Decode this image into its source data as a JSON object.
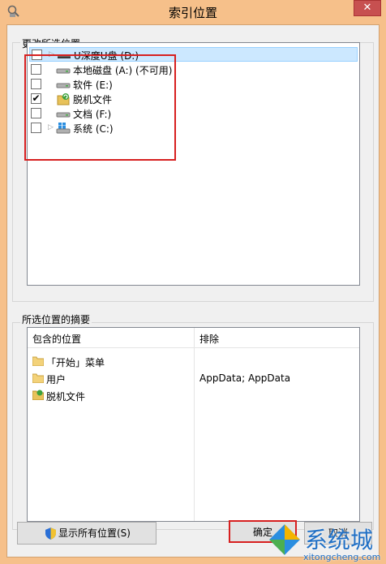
{
  "window": {
    "title": "索引位置",
    "close_glyph": "✕"
  },
  "change_group": {
    "label": "更改所选位置",
    "items": [
      {
        "label": "U深度U盘 (D:)",
        "checked": false,
        "expandable": true,
        "icon": "usb-drive-icon",
        "selected": true
      },
      {
        "label": "本地磁盘 (A:) (不可用)",
        "checked": false,
        "expandable": false,
        "icon": "drive-icon"
      },
      {
        "label": "软件 (E:)",
        "checked": false,
        "expandable": false,
        "icon": "drive-icon"
      },
      {
        "label": "脱机文件",
        "checked": true,
        "expandable": false,
        "icon": "offline-files-icon"
      },
      {
        "label": "文档 (F:)",
        "checked": false,
        "expandable": false,
        "icon": "drive-icon"
      },
      {
        "label": "系统 (C:)",
        "checked": false,
        "expandable": true,
        "icon": "system-drive-icon"
      }
    ],
    "check_glyph": "✔",
    "expander_glyph": "▷"
  },
  "summary_group": {
    "label": "所选位置的摘要",
    "columns": {
      "included": "包含的位置",
      "excluded": "排除"
    },
    "rows": [
      {
        "included": "「开始」菜单",
        "excluded": "",
        "icon": "folder-icon"
      },
      {
        "included": "用户",
        "excluded": "AppData; AppData",
        "icon": "folder-icon"
      },
      {
        "included": "脱机文件",
        "excluded": "",
        "icon": "offline-files-icon"
      }
    ]
  },
  "buttons": {
    "show_all": "显示所有位置(S)",
    "ok": "确定",
    "cancel": "取消"
  },
  "watermark": {
    "text": "系统城",
    "url_text": "xitongcheng.com"
  },
  "colors": {
    "title_bar": "#f6c08a",
    "selection": "#cce8ff",
    "highlight": "#d72020",
    "close": "#c75050"
  }
}
